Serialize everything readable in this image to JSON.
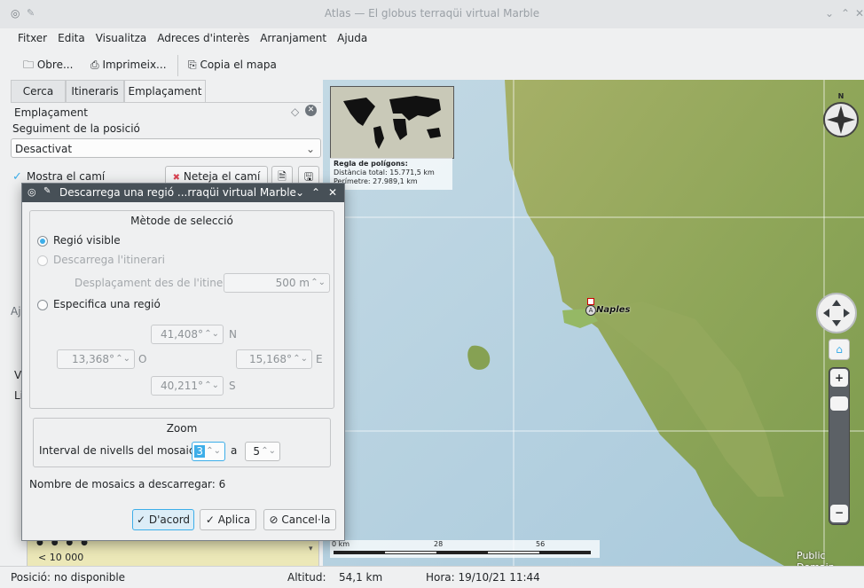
{
  "window": {
    "title": "Atlas — El globus terraqüi virtual Marble"
  },
  "menu": [
    "Fitxer",
    "Edita",
    "Visualitza",
    "Adreces d'interès",
    "Arranjament",
    "Ajuda"
  ],
  "toolbar": {
    "open": "Obre...",
    "print": "Imprimeix...",
    "copy_map": "Copia el mapa"
  },
  "tabs": [
    "Cerca",
    "Itineraris",
    "Emplaçament"
  ],
  "location_panel": {
    "header": "Emplaçament",
    "tracking_label": "Seguiment de la posició",
    "tracking_value": "Desactivat",
    "show_path": "Mostra el camí",
    "clear_path": "Neteja el camí",
    "scale_text": "< 10 000",
    "partial_label": "Aj",
    "partial_v": "V",
    "partial_l": "Li"
  },
  "overview": {
    "ruler_title": "Regla de polígons:",
    "total_distance": "Distància total: 15.771,5 km",
    "perimeter": "Perímetre: 27.989,1 km"
  },
  "map": {
    "city": "Naples",
    "compass_n": "N",
    "scale_labels": [
      "0 km",
      "28",
      "56"
    ],
    "license": "Public Domain"
  },
  "dialog": {
    "title": "Descarrega una regió ...rraqüi virtual Marble",
    "selection_group": "Mètode de selecció",
    "visible_region": "Regió visible",
    "download_route": "Descarrega l'itinerari",
    "route_offset_label": "Desplaçament des de l'itinerari:",
    "route_offset_value": "500 m",
    "specify_region": "Especifica una regió",
    "north": "41,408°",
    "north_unit": "N",
    "west": "13,368°",
    "west_unit": "O",
    "east": "15,168°",
    "east_unit": "E",
    "south": "40,211°",
    "south_unit": "S",
    "zoom_group": "Zoom",
    "tile_levels_label": "Interval de nivells del mosaic:",
    "level_from": "3",
    "level_sep": "a",
    "level_to": "5",
    "tile_count_label": "Nombre de mosaics a descarregar: 6",
    "ok": "D'acord",
    "apply": "Aplica",
    "cancel": "Cancel·la"
  },
  "status": {
    "position": "Posició: no disponible",
    "altitude_label": "Altitud:",
    "altitude_value": "54,1 km",
    "time": "Hora: 19/10/21 11:44"
  },
  "colors": {
    "accent": "#3daee9",
    "dialog_title": "#475057",
    "sea": "#b7d2e0",
    "land": "#8aa25a"
  }
}
